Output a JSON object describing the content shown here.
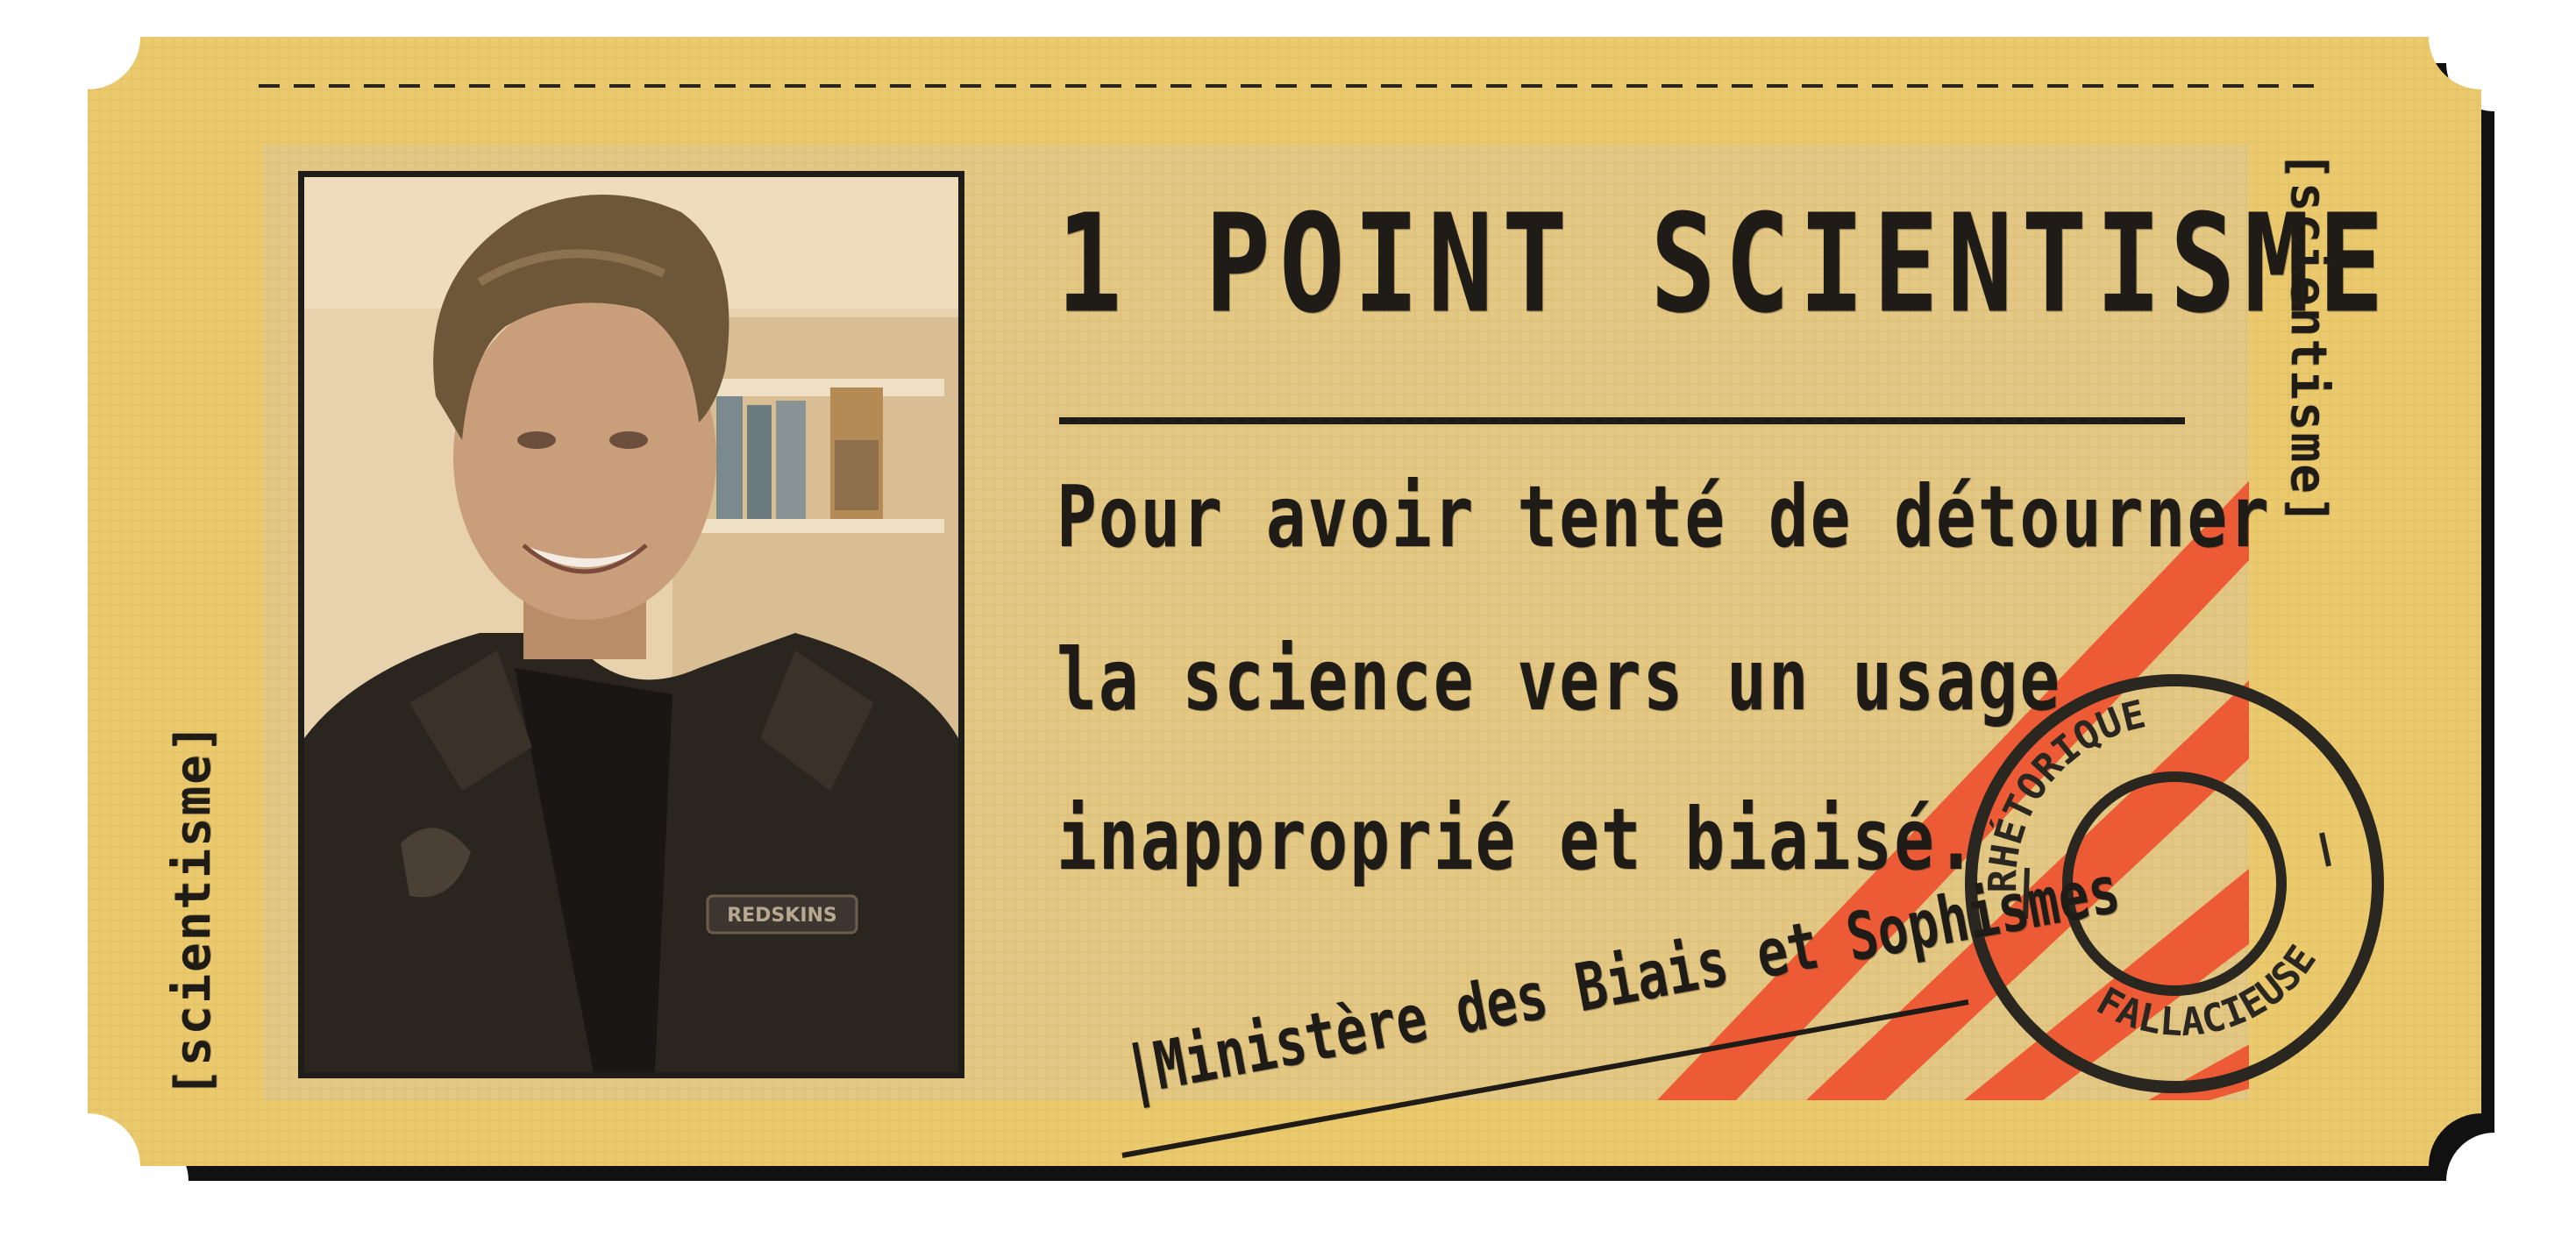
{
  "ticket": {
    "title": "1 POINT SCIENTISME",
    "body_lines": [
      "Pour avoir tenté de détourner",
      "la science vers un usage",
      "inapproprié et biaisé."
    ],
    "side_label_left": "[scientisme]",
    "side_label_right": "[scientisme]",
    "signature": "|Ministère des Biais et Sophismes",
    "stamp": {
      "top_text": "RHÉTORIQUE",
      "bottom_text": "FALLACIEUSE"
    },
    "photo": {
      "jacket_patch": "REDSKINS"
    }
  },
  "colors": {
    "ticket_fill": "#ebc96d",
    "inner_panel": "#e3c784",
    "ink": "#1f1c17",
    "stripe": "#ec5b35",
    "photo_tint": "#c8a770"
  }
}
